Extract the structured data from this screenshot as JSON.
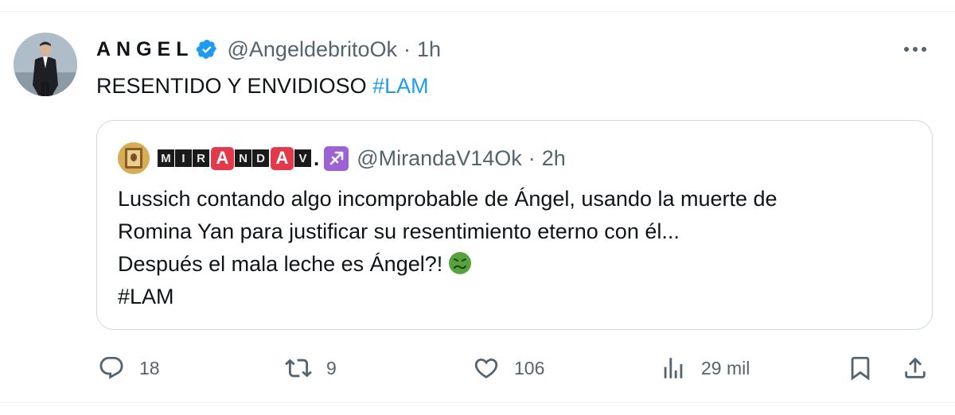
{
  "tweet": {
    "display_name": "ANGEL",
    "handle": "@AngeldebritoOk",
    "separator": "·",
    "time": "1h",
    "text": "RESENTIDO Y ENVIDIOSO ",
    "hashtag": "#LAM"
  },
  "quote": {
    "name_letters": [
      "M",
      "I",
      "R",
      "A",
      "N",
      "D",
      "A",
      "V",
      "."
    ],
    "handle": "@MirandaV14Ok",
    "separator": "·",
    "time": "2h",
    "lines": [
      "Lussich contando algo incomprobable de Ángel, usando la muerte de",
      "Romina Yan para justificar su resentimiento eterno con él...",
      "Después el mala leche es Ángel?!",
      "#LAM"
    ]
  },
  "actions": {
    "replies": "18",
    "retweets": "9",
    "likes": "106",
    "views": "29 mil"
  },
  "colors": {
    "link": "#1d9bf0",
    "verified": "#1d9bf0",
    "secondary_text": "#536471",
    "border": "#cfd9de",
    "sagittarius_bg": "#9d62d6",
    "emoji_face": "#56a33e"
  },
  "icons": [
    "verified-badge-icon",
    "more-icon",
    "sagittarius-icon",
    "nauseated-face-emoji",
    "reply-icon",
    "retweet-icon",
    "like-icon",
    "views-icon",
    "bookmark-icon",
    "share-icon"
  ]
}
